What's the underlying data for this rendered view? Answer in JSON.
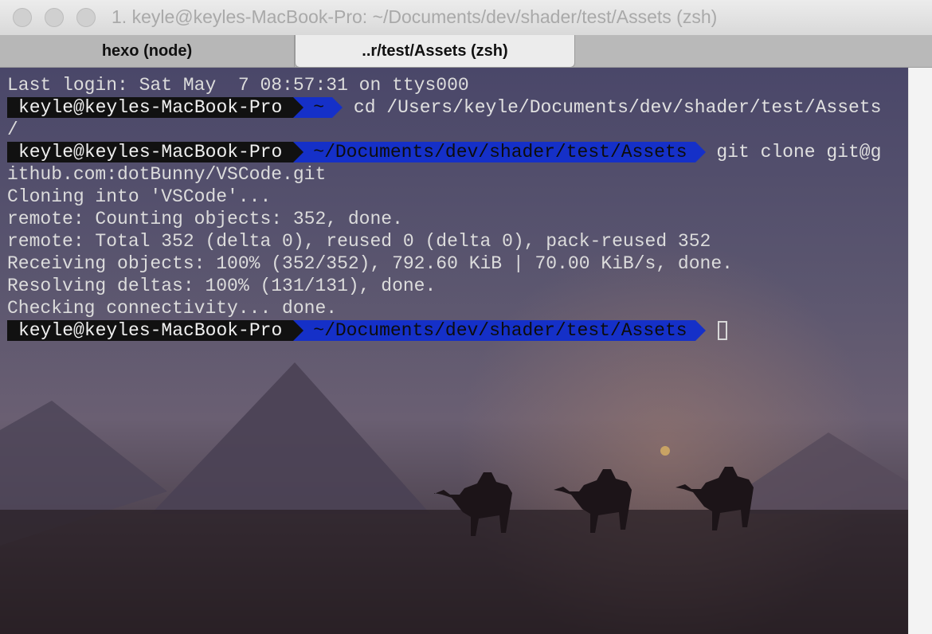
{
  "window": {
    "title": "1. keyle@keyles-MacBook-Pro: ~/Documents/dev/shader/test/Assets (zsh)"
  },
  "tabs": [
    {
      "label": "hexo (node)"
    },
    {
      "label": "..r/test/Assets (zsh)"
    }
  ],
  "terminal": {
    "last_login": "Last login: Sat May  7 08:57:31 on ttys000",
    "prompt1": {
      "user": "keyle@keyles-MacBook-Pro",
      "dir": "~",
      "command": "cd /Users/keyle/Documents/dev/shader/test/Assets"
    },
    "wrap1": "/",
    "prompt2": {
      "user": "keyle@keyles-MacBook-Pro",
      "dir": "~/Documents/dev/shader/test/Assets",
      "command": "git clone git@g"
    },
    "output": [
      "ithub.com:dotBunny/VSCode.git",
      "Cloning into 'VSCode'...",
      "remote: Counting objects: 352, done.",
      "remote: Total 352 (delta 0), reused 0 (delta 0), pack-reused 352",
      "Receiving objects: 100% (352/352), 792.60 KiB | 70.00 KiB/s, done.",
      "Resolving deltas: 100% (131/131), done.",
      "Checking connectivity... done."
    ],
    "prompt3": {
      "user": "keyle@keyles-MacBook-Pro",
      "dir": "~/Documents/dev/shader/test/Assets",
      "command": ""
    }
  },
  "colors": {
    "prompt_user_bg": "#111111",
    "prompt_dir_bg": "#1530c8",
    "terminal_text": "#dcdcdc"
  }
}
